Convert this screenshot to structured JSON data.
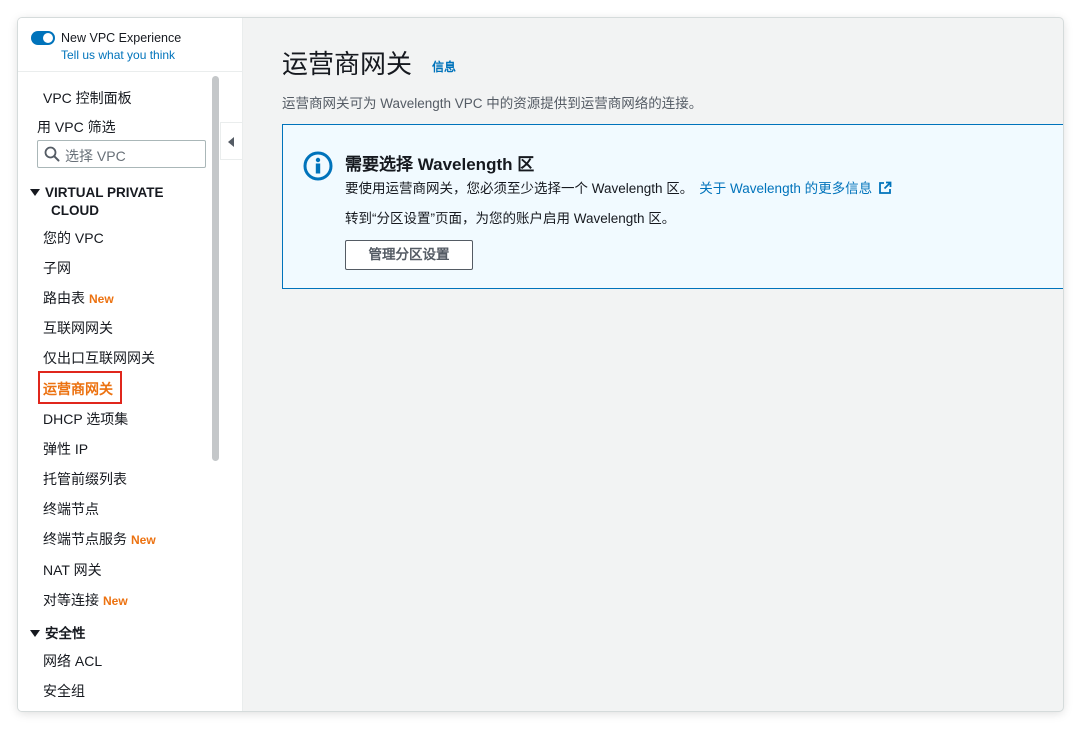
{
  "sidebar": {
    "toggle_label": "New VPC Experience",
    "feedback_link": "Tell us what you think",
    "dashboard": "VPC 控制面板",
    "filter_label": "用 VPC 筛选",
    "filter_placeholder": "选择 VPC",
    "section_vpc": "VIRTUAL PRIVATE CLOUD",
    "section_vpc_line1": "VIRTUAL PRIVATE",
    "section_vpc_line2": "CLOUD",
    "items": [
      {
        "label": "您的 VPC",
        "badge": ""
      },
      {
        "label": "子网",
        "badge": ""
      },
      {
        "label": "路由表",
        "badge": "New"
      },
      {
        "label": "互联网网关",
        "badge": ""
      },
      {
        "label": "仅出口互联网网关",
        "badge": ""
      },
      {
        "label": "运营商网关",
        "badge": ""
      },
      {
        "label": "DHCP 选项集",
        "badge": ""
      },
      {
        "label": "弹性 IP",
        "badge": ""
      },
      {
        "label": "托管前缀列表",
        "badge": ""
      },
      {
        "label": "终端节点",
        "badge": ""
      },
      {
        "label": "终端节点服务",
        "badge": "New"
      },
      {
        "label": "NAT 网关",
        "badge": ""
      },
      {
        "label": "对等连接",
        "badge": "New"
      }
    ],
    "section_security": "安全性",
    "security_items": [
      {
        "label": "网络 ACL"
      },
      {
        "label": "安全组"
      }
    ]
  },
  "main": {
    "title": "运营商网关",
    "info": "信息",
    "description": "运营商网关可为 Wavelength VPC 中的资源提供到运营商网络的连接。",
    "alert": {
      "title": "需要选择 Wavelength 区",
      "text1": "要使用运营商网关，您必须至少选择一个 Wavelength 区。",
      "link": "关于 Wavelength 的更多信息",
      "text2": "转到“分区设置”页面，为您的账户启用 Wavelength 区。",
      "button": "管理分区设置"
    }
  },
  "colors": {
    "accent_blue": "#0073bb",
    "active_orange": "#ec7211",
    "highlight_red": "#e0261c"
  }
}
